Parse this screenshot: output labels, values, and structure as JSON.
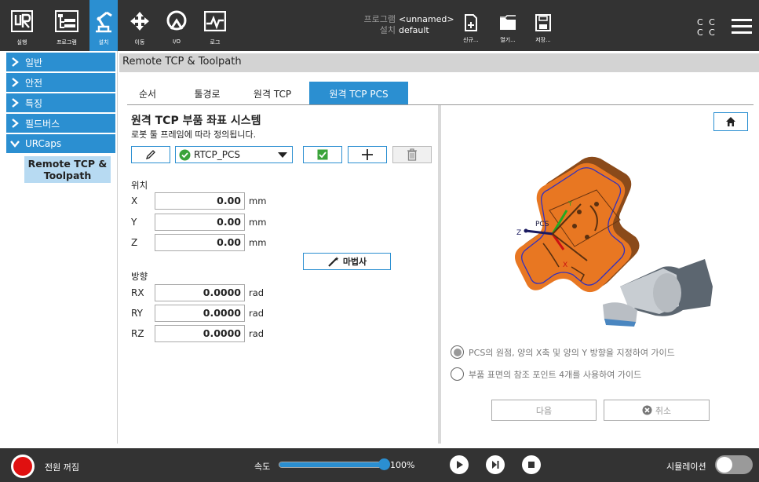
{
  "topbar": {
    "tabs": [
      {
        "label": "실행",
        "icon": "ur-logo-icon"
      },
      {
        "label": "프로그램",
        "icon": "program-icon"
      },
      {
        "label": "설치",
        "icon": "installation-robot-icon"
      },
      {
        "label": "이동",
        "icon": "move-arrows-icon"
      },
      {
        "label": "I/O",
        "icon": "io-icon"
      },
      {
        "label": "로그",
        "icon": "log-icon"
      }
    ],
    "program_key": "프로그램",
    "program_value": "<unnamed>",
    "install_key": "설치",
    "install_value": "default",
    "file_buttons": [
      {
        "label": "신규...",
        "icon": "new-file-icon"
      },
      {
        "label": "열기...",
        "icon": "open-folder-icon"
      },
      {
        "label": "저장...",
        "icon": "save-icon"
      }
    ],
    "cc_line1": "C C",
    "cc_line2": "C C"
  },
  "sidebar": {
    "items": [
      {
        "label": "일반"
      },
      {
        "label": "안전"
      },
      {
        "label": "특징"
      },
      {
        "label": "필드버스"
      },
      {
        "label": "URCaps"
      }
    ],
    "sub_item": "Remote TCP & Toolpath"
  },
  "header": {
    "title": "Remote TCP & Toolpath"
  },
  "tabs": [
    {
      "label": "순서"
    },
    {
      "label": "툴경로"
    },
    {
      "label": "원격 TCP"
    },
    {
      "label": "원격 TCP PCS"
    }
  ],
  "left": {
    "title": "원격 TCP 부품 좌표 시스템",
    "subtitle": "로봇 툴 프레임에 따라 정의됩니다.",
    "tcp_selected": "RTCP_PCS",
    "position_label": "위치",
    "position": [
      {
        "axis": "X",
        "value": "0.00",
        "unit": "mm"
      },
      {
        "axis": "Y",
        "value": "0.00",
        "unit": "mm"
      },
      {
        "axis": "Z",
        "value": "0.00",
        "unit": "mm"
      }
    ],
    "wizard_label": "마법사",
    "orientation_label": "방향",
    "orientation": [
      {
        "axis": "RX",
        "value": "0.0000",
        "unit": "rad"
      },
      {
        "axis": "RY",
        "value": "0.0000",
        "unit": "rad"
      },
      {
        "axis": "RZ",
        "value": "0.0000",
        "unit": "rad"
      }
    ]
  },
  "right": {
    "illustration": {
      "label_pcs": "PCS",
      "label_x": "X",
      "label_y": "Y",
      "label_z": "Z"
    },
    "radio_options": [
      {
        "label": "PCS의 원점, 양의 X축 및 양의 Y 방향을 지정하여 가이드",
        "selected": true
      },
      {
        "label": "부품 표면의 참조 포인트 4개를 사용하여 가이드",
        "selected": false
      }
    ],
    "next_label": "다음",
    "cancel_label": "취소"
  },
  "bottombar": {
    "power_label": "전원 꺼짐",
    "speed_label": "속도",
    "speed_value": "100%",
    "speed_fraction": 1.0,
    "sim_label": "시뮬레이션"
  },
  "colors": {
    "accent": "#2b8fd1",
    "topbar": "#333333",
    "part_orange": "#e87722"
  }
}
